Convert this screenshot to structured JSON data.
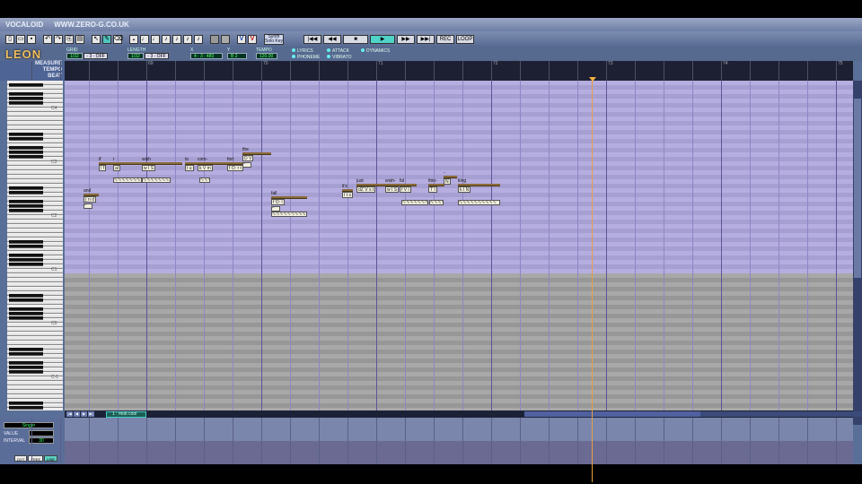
{
  "window": {
    "title": "VOCALOID",
    "url": "WWW.ZERO-G.CO.UK",
    "logo": "LEON"
  },
  "toolbar": {
    "note_buttons": [
      "𝅝",
      "♩",
      "♩",
      "♪",
      "♪",
      "♪",
      "♪"
    ],
    "synth_label": "Synth Solo Key",
    "transport": [
      "|◀◀",
      "◀◀",
      "■",
      "▶",
      "▶▶",
      "▶▶|",
      "REC",
      "LOOP"
    ],
    "v_buttons": [
      "V",
      "V"
    ]
  },
  "params": {
    "grid": {
      "label": "GRID",
      "value": "1/32",
      "toggle": "- 3 - OFF"
    },
    "length": {
      "label": "LENGTH",
      "value": "1/32",
      "toggle": "- 3 - OFF"
    },
    "x": {
      "label": "X",
      "value": "4 : 3 : 480"
    },
    "y": {
      "label": "Y",
      "value": "B 2"
    },
    "tempo": {
      "label": "TEMPO",
      "value": "120.00"
    },
    "radios": [
      "LYRICS",
      "ATTACK",
      "DYNAMICS",
      "PHONEME",
      "VIBRATO"
    ]
  },
  "ruler": {
    "rows": [
      "MEASURE",
      "TEMPO",
      "BEAT"
    ],
    "measures": [
      "69",
      "70",
      "71",
      "72",
      "73",
      "74",
      "75"
    ]
  },
  "keyboard": {
    "octave_labels": [
      "C4",
      "C3",
      "C2",
      "C1",
      "C0",
      "C-1"
    ]
  },
  "notes": [
    {
      "lyric": "if",
      "phoneme": "I f"
    },
    {
      "lyric": "i",
      "phoneme": "aI"
    },
    {
      "lyric": "wish",
      "phoneme": "w I S"
    },
    {
      "lyric": "to",
      "phoneme": "t u"
    },
    {
      "lyric": "com-",
      "phoneme": "k V m"
    },
    {
      "lyric": "fort",
      "phoneme": "f O: r t"
    },
    {
      "lyric": "the",
      "phoneme": "D V"
    },
    {
      "lyric": "and",
      "phoneme": "{ n d"
    },
    {
      "lyric": "fall",
      "phoneme": "f O: l"
    },
    {
      "lyric": "it's",
      "phoneme": "I t s"
    },
    {
      "lyric": "just",
      "phoneme": "dZ V s t"
    },
    {
      "lyric": "wish-",
      "phoneme": "w I S"
    },
    {
      "lyric": "ful",
      "phoneme": "f V l"
    },
    {
      "lyric": "thin-",
      "phoneme": "T I"
    },
    {
      "lyric": "-",
      "phoneme": "N"
    },
    {
      "lyric": "king",
      "phoneme": "k I N"
    }
  ],
  "track": {
    "name": "1 : mob cool",
    "nav": [
      "|◀",
      "◀",
      "▶",
      "▶|"
    ]
  },
  "control": {
    "selector": "Singer",
    "value_label": "VALUE",
    "value": "",
    "interval_label": "INTERVAL",
    "interval": "30",
    "buttons": [
      "DOT",
      "FREE",
      "LINE"
    ]
  }
}
